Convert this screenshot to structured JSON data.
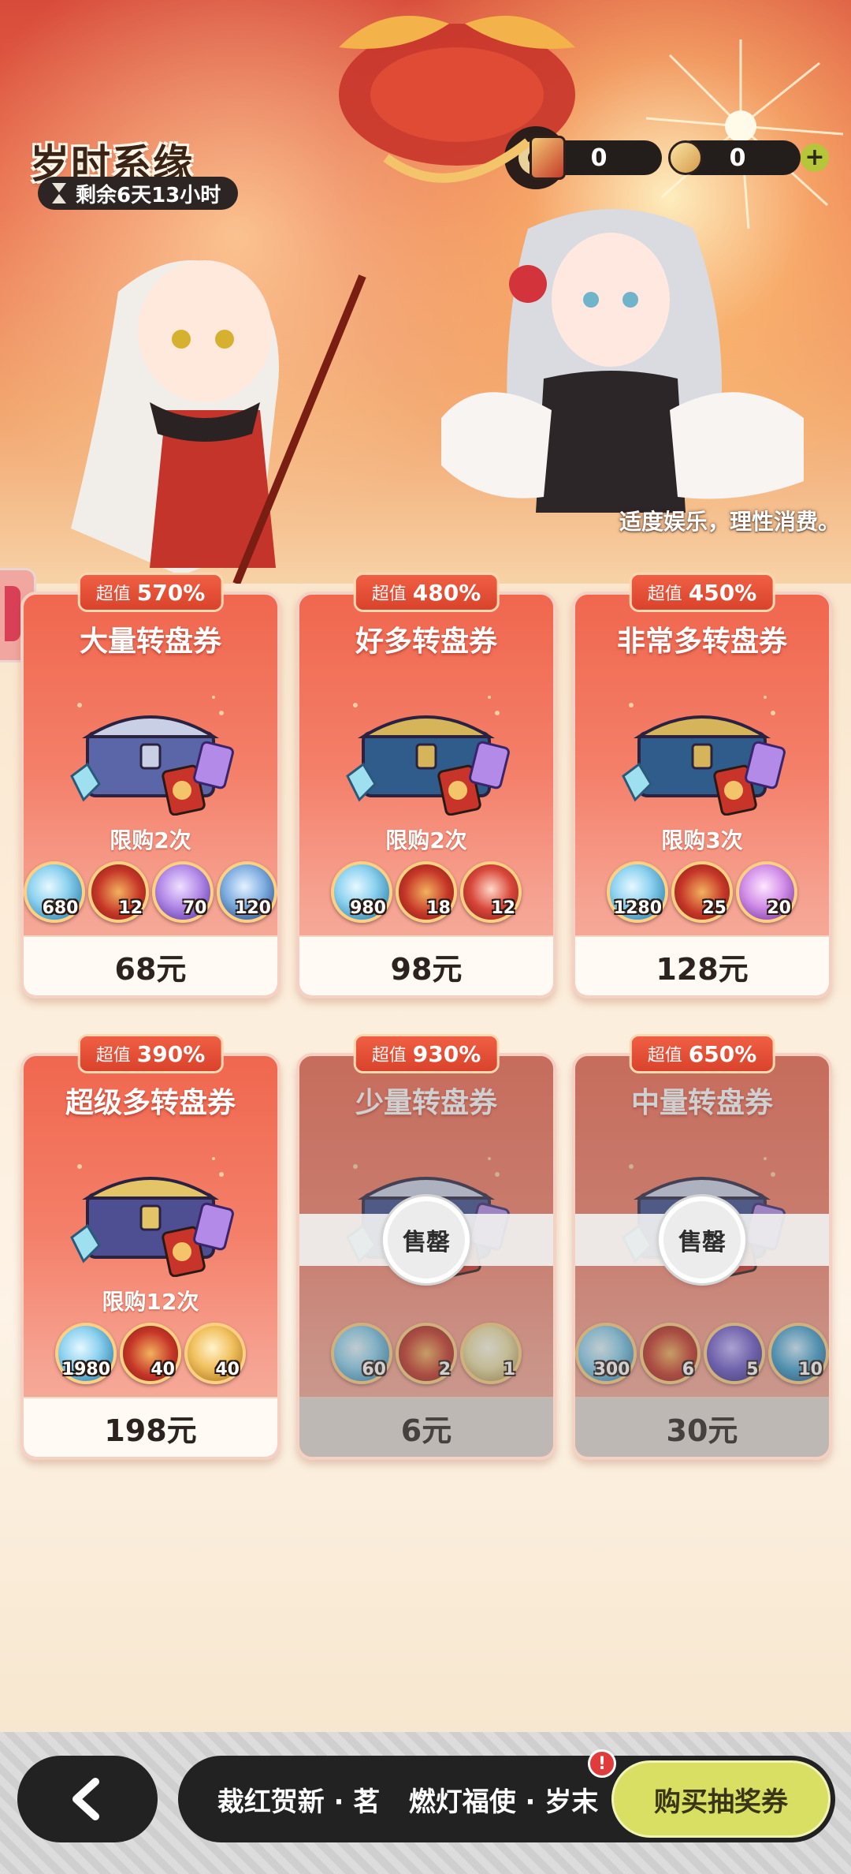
{
  "header": {
    "event_title": "岁时系缘",
    "time_left": "剩余6天13小时",
    "currencies": [
      {
        "name": "lottery-ticket",
        "value": "0"
      },
      {
        "name": "coin",
        "value": "0"
      }
    ],
    "plus_label": "+",
    "notice": "适度娱乐，理性消费。"
  },
  "packs": [
    {
      "badge_label": "超值",
      "badge_value": "570%",
      "title": "大量转盘券",
      "limit": "限购2次",
      "price": "68元",
      "sold_out": false,
      "items": [
        {
          "icon": "crystal",
          "qty": "680"
        },
        {
          "icon": "ticket",
          "qty": "12"
        },
        {
          "icon": "purple-card",
          "qty": "70"
        },
        {
          "icon": "blue-card",
          "qty": "120"
        }
      ]
    },
    {
      "badge_label": "超值",
      "badge_value": "480%",
      "title": "好多转盘券",
      "limit": "限购2次",
      "price": "98元",
      "sold_out": false,
      "items": [
        {
          "icon": "crystal",
          "qty": "980"
        },
        {
          "icon": "ticket",
          "qty": "18"
        },
        {
          "icon": "paw-token",
          "qty": "12"
        }
      ]
    },
    {
      "badge_label": "超值",
      "badge_value": "450%",
      "title": "非常多转盘券",
      "limit": "限购3次",
      "price": "128元",
      "sold_out": false,
      "items": [
        {
          "icon": "crystal",
          "qty": "1280"
        },
        {
          "icon": "ticket",
          "qty": "25"
        },
        {
          "icon": "purple-gem",
          "qty": "20"
        }
      ]
    },
    {
      "badge_label": "超值",
      "badge_value": "390%",
      "title": "超级多转盘券",
      "limit": "限购12次",
      "price": "198元",
      "sold_out": false,
      "items": [
        {
          "icon": "crystal",
          "qty": "1980"
        },
        {
          "icon": "ticket",
          "qty": "40"
        },
        {
          "icon": "gold-ticket",
          "qty": "40"
        }
      ]
    },
    {
      "badge_label": "超值",
      "badge_value": "930%",
      "title": "少量转盘券",
      "limit": "",
      "price": "6元",
      "sold_out": true,
      "sold_label": "售罄",
      "items": [
        {
          "icon": "crystal",
          "qty": "60"
        },
        {
          "icon": "ticket",
          "qty": "2"
        },
        {
          "icon": "clover-card",
          "qty": "1"
        }
      ]
    },
    {
      "badge_label": "超值",
      "badge_value": "650%",
      "title": "中量转盘券",
      "limit": "",
      "price": "30元",
      "sold_out": true,
      "sold_label": "售罄",
      "items": [
        {
          "icon": "crystal",
          "qty": "300"
        },
        {
          "icon": "ticket",
          "qty": "6"
        },
        {
          "icon": "mystery-gift-purple",
          "qty": "5"
        },
        {
          "icon": "mystery-gift-blue",
          "qty": "10"
        }
      ]
    }
  ],
  "bottom_nav": {
    "back_label": "back",
    "tabs": [
      "裁红贺新 · 茗",
      "燃灯福使 · 岁末"
    ],
    "active_tab": "购买抽奖券",
    "alert": "!"
  }
}
